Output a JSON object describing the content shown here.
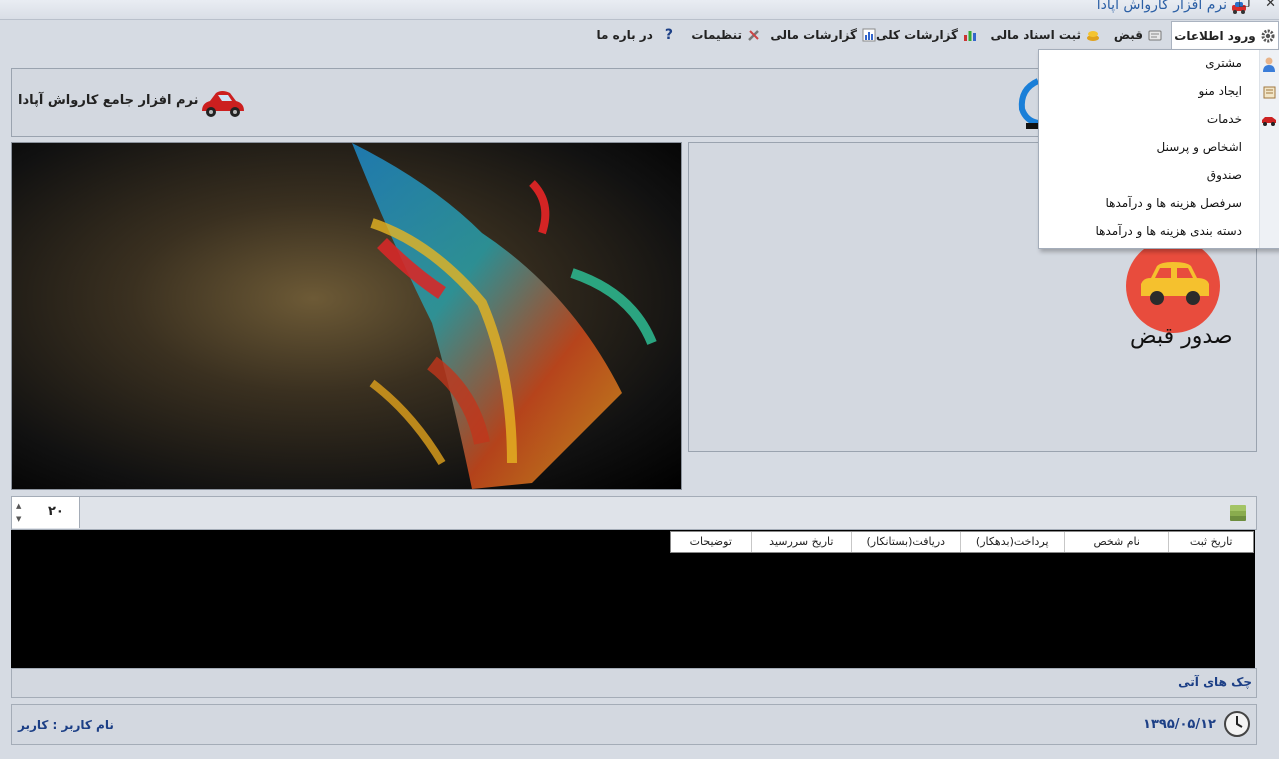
{
  "window": {
    "title": "نرم افزار کارواش آپادا",
    "close_glyph": "✕",
    "restore_glyph": "❐"
  },
  "menu": {
    "items": [
      {
        "label": "ورود اطلاعات",
        "icon": "gear-icon"
      },
      {
        "label": "قبض",
        "icon": "receipt-icon"
      },
      {
        "label": "ثبت اسناد مالی",
        "icon": "coins-icon"
      },
      {
        "label": "گزارشات کلی",
        "icon": "bar-chart-icon"
      },
      {
        "label": "گزارشات مالی",
        "icon": "report-chart-icon"
      },
      {
        "label": "تنظیمات",
        "icon": "tools-icon"
      },
      {
        "label": "در باره ما",
        "icon": "question-icon"
      }
    ]
  },
  "dropdown": {
    "items": [
      {
        "label": "مشتری",
        "icon": "customer-icon"
      },
      {
        "label": "ایجاد منو",
        "icon": "menu-book-icon"
      },
      {
        "label": "خدمات",
        "icon": "car-service-icon"
      },
      {
        "label": "اشخاص و پرسنل",
        "icon": ""
      },
      {
        "label": "صندوق",
        "icon": ""
      },
      {
        "label": "سرفصل هزینه ها و درآمدها",
        "icon": ""
      },
      {
        "label": "دسته بندی هزینه ها و درآمدها",
        "icon": ""
      }
    ]
  },
  "header": {
    "app_name": "نرم افزار جامع کارواش آپادا"
  },
  "dashboard": {
    "receipt_button_label": "صدور قبض"
  },
  "cheques": {
    "days_value": "۲۰",
    "columns": [
      "تاریخ ثبت",
      "نام شخص",
      "پرداخت(بدهکار)",
      "دریافت(بستانکار)",
      "تاریخ سررسید",
      "توضیحات"
    ],
    "section_label": "چک های آتی"
  },
  "status": {
    "user": "نام کاربر : کاربر",
    "date": "۱۳۹۵/۰۵/۱۲"
  },
  "colors": {
    "accent_blue": "#1c3f86",
    "receipt_circle": "#e84c3d",
    "car_yellow": "#f5c12e"
  }
}
